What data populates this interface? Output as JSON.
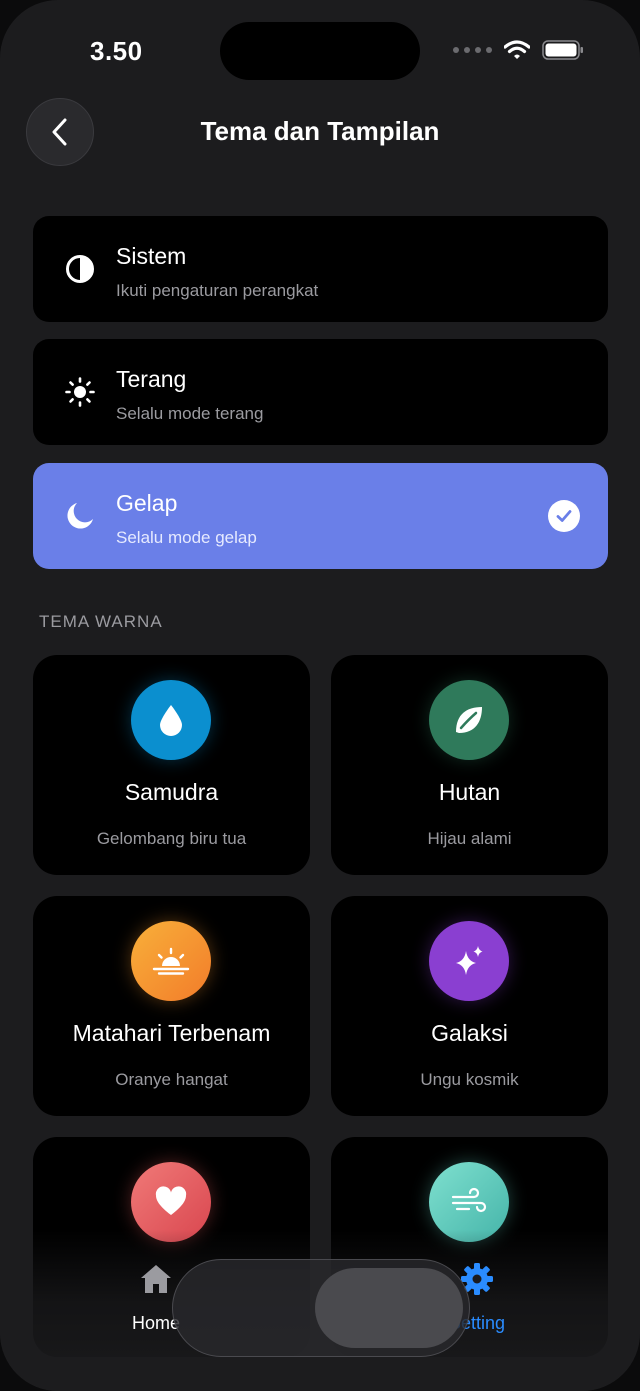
{
  "status": {
    "time": "3.50"
  },
  "header": {
    "title": "Tema dan Tampilan"
  },
  "modes": [
    {
      "title": "Sistem",
      "subtitle": "Ikuti pengaturan perangkat",
      "icon": "half-circle-icon",
      "selected": false
    },
    {
      "title": "Terang",
      "subtitle": "Selalu mode terang",
      "icon": "sun-icon",
      "selected": false
    },
    {
      "title": "Gelap",
      "subtitle": "Selalu mode gelap",
      "icon": "moon-icon",
      "selected": true
    }
  ],
  "section": {
    "label": "TEMA WARNA"
  },
  "themes": [
    {
      "name": "Samudra",
      "subtitle": "Gelombang biru tua",
      "icon": "droplet-icon",
      "color": "#0b8fcf"
    },
    {
      "name": "Hutan",
      "subtitle": "Hijau alami",
      "icon": "leaf-icon",
      "color": "#2f7a5b"
    },
    {
      "name": "Matahari Terbenam",
      "subtitle": "Oranye hangat",
      "icon": "sunset-icon",
      "color": "#f5962e"
    },
    {
      "name": "Galaksi",
      "subtitle": "Ungu kosmik",
      "icon": "sparkle-icon",
      "color": "#8a3fd1"
    },
    {
      "name": "",
      "subtitle": "",
      "icon": "heart-icon",
      "color": "#e45d5d"
    },
    {
      "name": "",
      "subtitle": "",
      "icon": "wind-icon",
      "color": "#5ec8bb"
    }
  ],
  "tabbar": {
    "items": [
      {
        "label": "Home",
        "icon": "house-icon",
        "active": false
      },
      {
        "label": "Setting",
        "icon": "gear-icon",
        "active": true
      }
    ]
  },
  "colors": {
    "accent": "#6a7fe8",
    "active_tab": "#2a8cff",
    "card": "#000000",
    "background": "#1c1c1e"
  }
}
